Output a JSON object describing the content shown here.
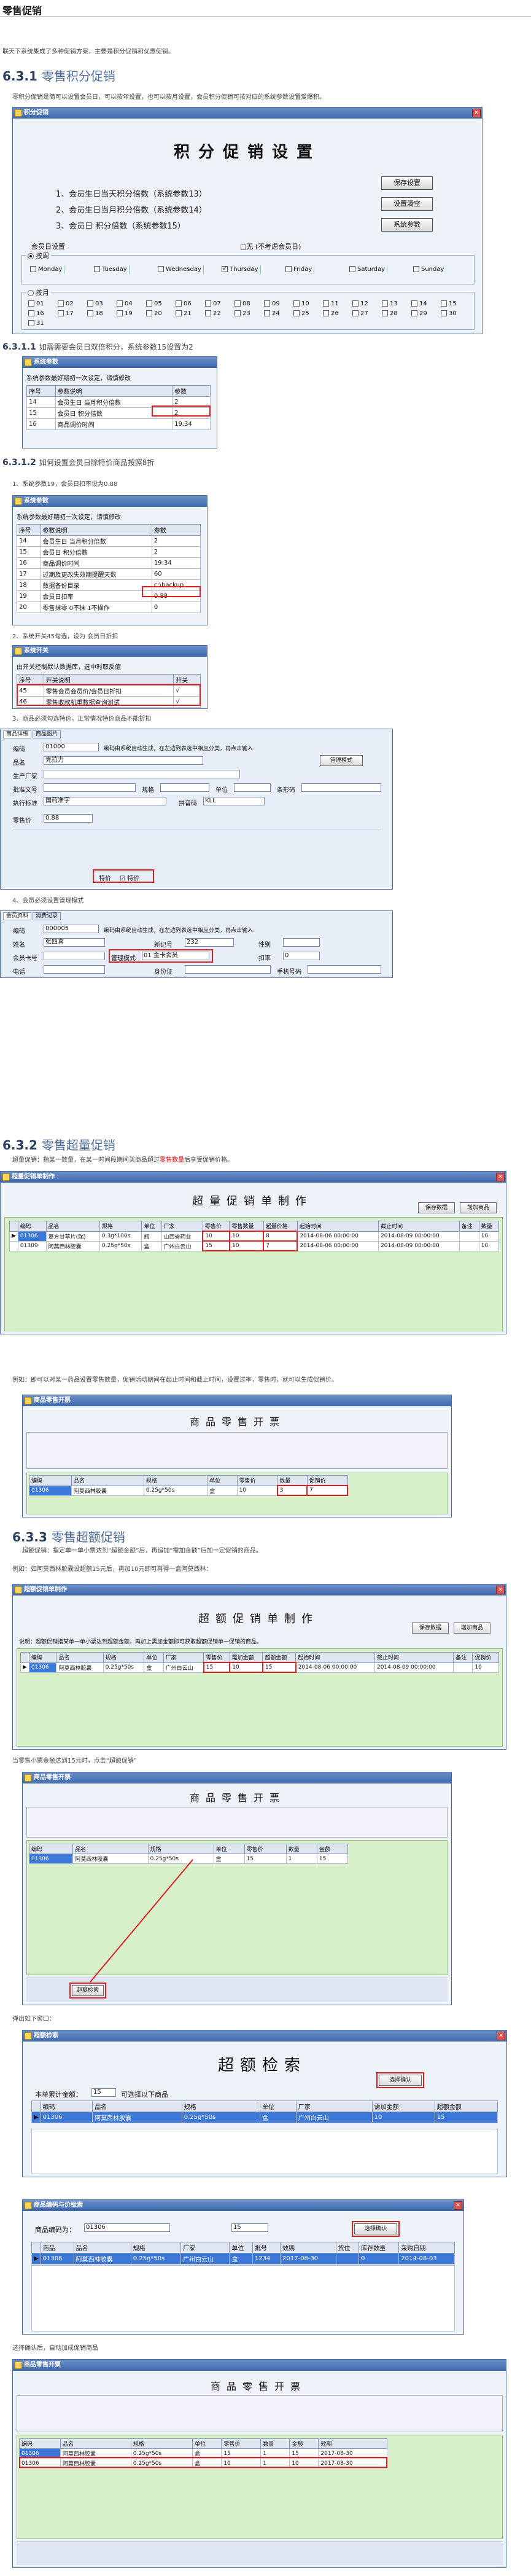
{
  "page": {
    "title": "零售促销",
    "intro": "联天下系统集成了多种促销方案，主要是积分促销和优惠促销。"
  },
  "s631": {
    "heading_num": "6.3.1",
    "heading_text": "零售积分促销",
    "desc": "零积分促销是简可以设置会员日，可以按年设置，也可以按月设置，会员积分促销可按对应的系统参数设置爱爆积。",
    "window_title": "积分促销",
    "banner": "积分促销设置",
    "rules": [
      "1、会员生日当天积分倍数（系统参数13）",
      "2、会员生日当月积分倍数（系统参数14）",
      "3、会员日 积分倍数（系统参数15）"
    ],
    "buttons": {
      "save": "保存设置",
      "clear": "设置清空",
      "params": "系统参数"
    },
    "member_day_label": "会员日设置",
    "no_member_day": "□无 (不考虑会员日)",
    "by_week": "按周",
    "by_month": "按月",
    "weekdays": [
      "Monday",
      "Tuesday",
      "Wednesday",
      "Thursday",
      "Friday",
      "Saturday",
      "Sunday"
    ],
    "days": [
      "01",
      "02",
      "03",
      "04",
      "05",
      "06",
      "07",
      "08",
      "09",
      "10",
      "11",
      "12",
      "13",
      "14",
      "15",
      "16",
      "17",
      "18",
      "19",
      "20",
      "21",
      "22",
      "23",
      "24",
      "25",
      "26",
      "27",
      "28",
      "29",
      "30",
      "31"
    ]
  },
  "s6311": {
    "heading_num": "6.3.1.1",
    "heading_text": "如需需要会员日双倍积分，系统参数15设置为2",
    "window_title": "系统参数",
    "hint": "系统参数最好期初一次设定，请慎修改",
    "cols": [
      "序号",
      "参数说明",
      "参数"
    ],
    "rows": [
      [
        "14",
        "会员生日 当月积分倍数",
        "2"
      ],
      [
        "15",
        "会员日 积分倍数",
        "2"
      ],
      [
        "16",
        "商品调价时间",
        "19:34"
      ]
    ]
  },
  "s6312": {
    "heading_num": "6.3.1.2",
    "heading_text": "如何设置会员日除特价商品按照8折",
    "step1": "1、系统参数19，会员日扣率设为0.88",
    "window_title": "系统参数",
    "hint": "系统参数最好期初一次设定，请慎修改",
    "cols": [
      "序号",
      "参数说明",
      "参数"
    ],
    "rows": [
      [
        "14",
        "会员生日 当月积分倍数",
        "2"
      ],
      [
        "15",
        "会员日 积分倍数",
        "2"
      ],
      [
        "16",
        "商品调价时间",
        "19:34"
      ],
      [
        "17",
        "过期及更改失效期提醒天数",
        "60"
      ],
      [
        "18",
        "数据备份目录",
        "c:\\backup"
      ],
      [
        "19",
        "会员日扣率",
        "0.88"
      ],
      [
        "20",
        "零售抹零 0不抹 1不操作",
        "0"
      ]
    ],
    "step2": "2、系统开关45勾选，设为 会员日折扣",
    "switch_title": "系统开关",
    "switch_hint": "由开关控制默认数据库，选中时取反值",
    "switch_cols": [
      "序号",
      "开关说明",
      "开关"
    ],
    "switch_rows": [
      [
        "45",
        "零售会员会员价/会员日折扣",
        "√"
      ],
      [
        "46",
        "零售收款机重数据查询测试",
        "√"
      ]
    ],
    "step3": "3、商品必须勾选特价，正常情况特价商品不能折扣",
    "goods_tabs": [
      "商品详细",
      "商品图片"
    ],
    "goods_fields": {
      "code_label": "编码",
      "code": "01000",
      "code_hint": "编码由系统自动生成，在左边列表选中相应分类，再点击输入",
      "name_label": "品名",
      "name": "克拉力",
      "maker_label": "生产厂家",
      "approval_label": "批准文号",
      "approval": "",
      "spec_label": "规格",
      "spec": "",
      "unit_label": "单位",
      "barcode_label": "条形码",
      "std_label": "执行标准",
      "std": "国药准字",
      "pinyin_label": "拼音码",
      "pinyin": "KLL",
      "manage_btn": "管理模式",
      "price_label": "零售价",
      "price": "0.88",
      "special_label": "特价",
      "special": "☑ 特价"
    },
    "step4": "4、会员必须设置管理模式",
    "member_tabs": [
      "会员资料",
      "消费记录"
    ],
    "member_fields": {
      "code_label": "编码",
      "code": "000005",
      "code_hint": "编码由系统自动生成，在左边列表选中相应分类，再点击输入",
      "name_label": "姓名",
      "name": "张四喜",
      "mode_label": "管理模式",
      "mode": "01 金卡会员",
      "card_label": "会员卡号",
      "id_label": "身份证",
      "phone_label": "电话",
      "mobile_label": "手机号码",
      "new_label": "新记号",
      "new_val": "232",
      "gender_label": "性别",
      "discount_label": "扣率",
      "discount": "0"
    }
  },
  "s632": {
    "heading_num": "6.3.2",
    "heading_text": "零售超量促销",
    "desc_a": "超量促销：指某一数量，在某一时间段期间买商品超过",
    "desc_red": "零售数量",
    "desc_b": "后享受促销价格。",
    "window_title": "超量促销单制作",
    "banner": "超量促销单制作",
    "btn_save": "保存数据",
    "btn_add": "增加商品",
    "table_cols": [
      "编码",
      "品名",
      "规格",
      "单位",
      "厂家",
      "零售价",
      "零售数量",
      "超量价格",
      "起始时间",
      "截止时间",
      "备注",
      "数量"
    ],
    "table_rows": [
      [
        "01306",
        "复方甘草片(瑞)",
        "0.3g*100s",
        "瓶",
        "山西省药业",
        "10",
        "10",
        "8",
        "2014-08-06 00:00:00",
        "2014-08-09 00:00:00",
        "",
        "10"
      ],
      [
        "01309",
        "阿莫西林胶囊",
        "0.25g*50s",
        "盒",
        "广州白云山",
        "15",
        "10",
        "7",
        "2014-08-06 00:00:00",
        "2014-08-09 00:00:00",
        "",
        "10"
      ]
    ],
    "example": "例如：即可以对某一药品设置零售数量，促销活动期间在起止时间和截止时间，设置过率，零售时，就可以生成促销价。",
    "retail_title": "商品零售开票",
    "retail_row": [
      "01306",
      "阿莫西林胶囊",
      "0.25g*50s",
      "盒",
      "10",
      "3",
      "7"
    ]
  },
  "s633": {
    "heading_num": "6.3.3",
    "heading_text": "零售超额促销",
    "desc": "超额促销：指定单一单小票达到“超额金额”后，再追加“需加金额”后加一定促销的商品。",
    "example": "例如：如阿莫西林胶囊设超额15元后，再加10元即可再得一盒阿莫西林：",
    "window_title": "超额促销单制作",
    "banner": "超额促销单制作",
    "btn_save": "保存数据",
    "btn_add": "增加商品",
    "hint": "说明：超额促销指某单一单小票达到超额金额，再加上需加金额即可获取超额促销单一促销的商品。",
    "table_cols": [
      "编码",
      "品名",
      "规格",
      "单位",
      "厂家",
      "零售价",
      "需加金额",
      "超额金额",
      "起始时间",
      "截止时间",
      "备注",
      "促销价"
    ],
    "table_rows": [
      [
        "01306",
        "阿莫西林胶囊",
        "0.25g*50s",
        "盒",
        "广州白云山",
        "15",
        "10",
        "15",
        "2014-08-06 00:00:00",
        "2014-08-09 00:00:00",
        "",
        "10"
      ]
    ],
    "retail_note": "当零售小票金额达到15元时，点击“超额促销”",
    "retail_title": "商品零售开票",
    "popup_note": "弹出如下窗口：",
    "over_title": "超额检索",
    "over_banner": "超额检索",
    "over_label": "本单累计金额：",
    "over_value": "15",
    "over_tip": "可选择以下商品",
    "over_btn": "选择确认",
    "over_cols": [
      "编码",
      "品名",
      "规格",
      "单位",
      "厂家",
      "需加金额",
      "超额金额"
    ],
    "over_row": [
      "01306",
      "阿莫西林胶囊",
      "0.25g*50s",
      "盒",
      "广州白云山",
      "10",
      "15"
    ],
    "stock_title": "商品编码与价检索",
    "stock_label": "商品编码为：",
    "stock_value": "01306",
    "stock_value2": "15",
    "stock_btn": "选择确认",
    "stock_cols": [
      "商品",
      "品名",
      "规格",
      "厂家",
      "单位",
      "批号",
      "效期",
      "货位",
      "库存数量",
      "采购日期"
    ],
    "stock_row": [
      "01306",
      "阿莫西林胶囊",
      "0.25g*50s",
      "广州白云山",
      "盒",
      "1234",
      "2017-08-30",
      "",
      "0",
      "2014-08-03"
    ],
    "confirm_note": "选择确认后，自动加成促销商品",
    "final_title": "商品零售开票",
    "final_rows": [
      [
        "01306",
        "阿莫西林胶囊",
        "0.25g*50s",
        "盒",
        "15",
        "1",
        "15",
        "2017-08-30"
      ],
      [
        "01306",
        "阿莫西林胶囊",
        "0.25g*50s",
        "盒",
        "10",
        "1",
        "10",
        "2017-08-30"
      ]
    ]
  }
}
